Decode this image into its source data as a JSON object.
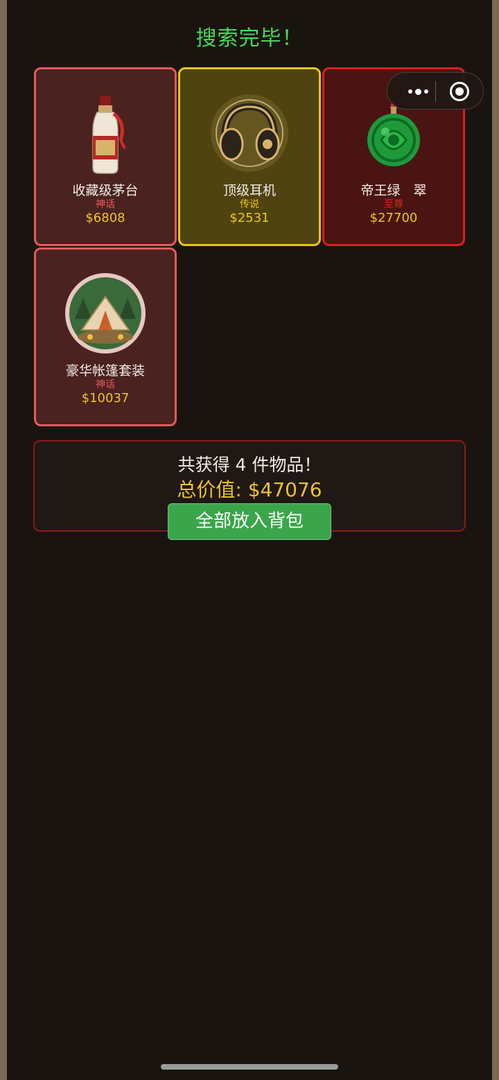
{
  "title": "搜索完毕！",
  "items": [
    {
      "name": "收藏级茅台",
      "rarity": "神话",
      "price": "$6808",
      "icon": "liquor-bottle-icon"
    },
    {
      "name": "顶级耳机",
      "rarity": "传说",
      "price": "$2531",
      "icon": "headphones-icon"
    },
    {
      "name": "帝王绿　翠",
      "rarity": "至尊",
      "price": "$27700",
      "icon": "jade-pendant-icon"
    },
    {
      "name": "豪华帐篷套装",
      "rarity": "神话",
      "price": "$10037",
      "icon": "tent-icon"
    }
  ],
  "summary": {
    "count_text": "共获得 4 件物品！",
    "total_text": "总价值: $47076",
    "button_label": "全部放入背包"
  },
  "capsule": {
    "more_icon": "more-dots-icon",
    "close_icon": "close-target-icon"
  },
  "colors": {
    "title": "#4cd65a",
    "myth": "#e85a5a",
    "legend": "#e8c51c",
    "supreme": "#d92020",
    "price": "#ecc52a",
    "button": "#3aa54a"
  }
}
